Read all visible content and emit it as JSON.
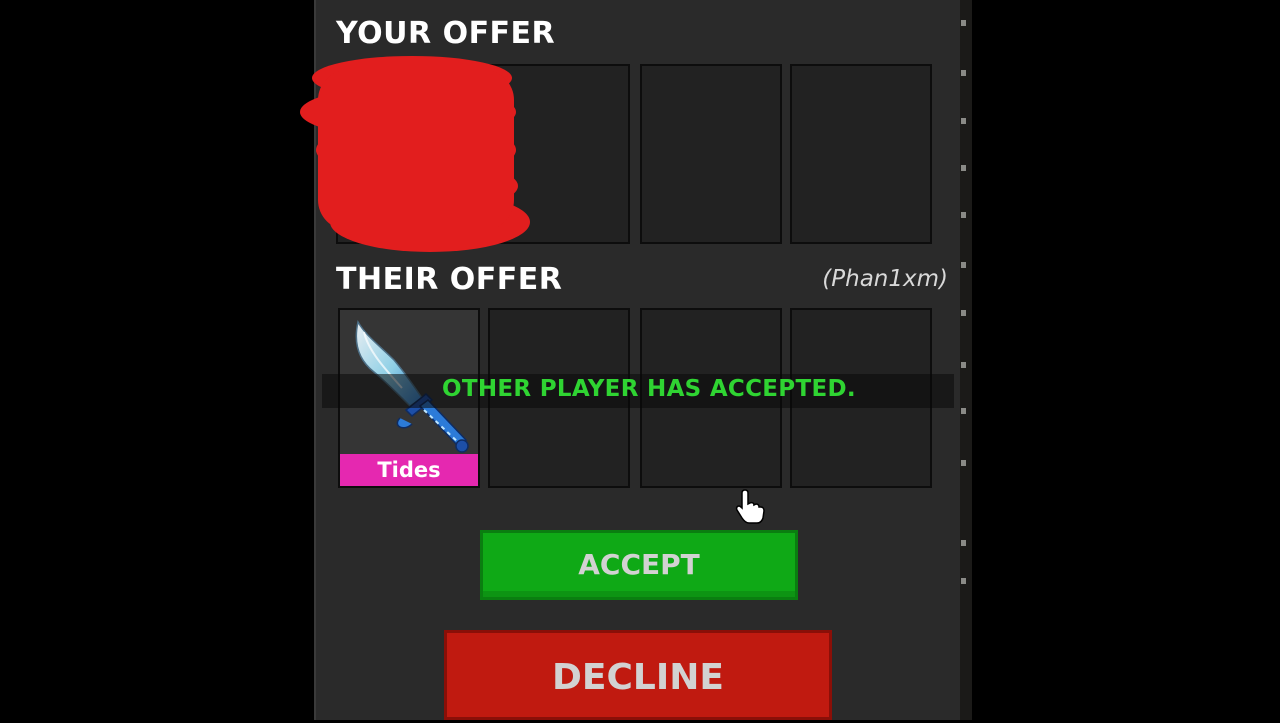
{
  "trade": {
    "your_offer_title": "YOUR OFFER",
    "their_offer_title": "THEIR OFFER",
    "partner_name": "(Phan1xm)",
    "status_message": "OTHER PLAYER HAS ACCEPTED.",
    "status_color": "#2fd432",
    "their_items": [
      {
        "name": "Tides",
        "tag_color": "#e528b0",
        "icon": "blue-knife-icon"
      }
    ],
    "accept_label": "ACCEPT",
    "decline_label": "DECLINE",
    "accept_color": "#0fa916",
    "decline_color": "#c01a10",
    "redaction_color": "#e21e1e"
  }
}
